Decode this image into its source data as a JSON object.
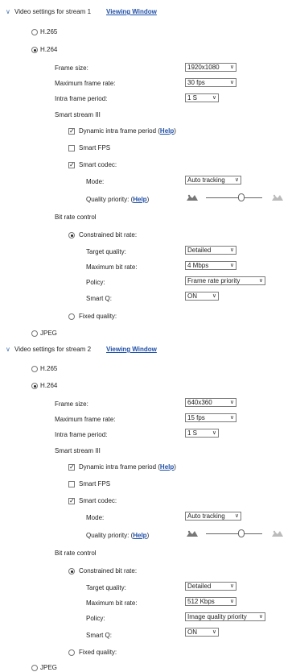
{
  "stream1": {
    "header": "Video settings for stream 1",
    "viewing_window": "Viewing Window",
    "h265": "H.265",
    "h264": "H.264",
    "frame_size_label": "Frame size:",
    "frame_size_value": "1920x1080",
    "max_frame_rate_label": "Maximum frame rate:",
    "max_frame_rate_value": "30 fps",
    "intra_period_label": "Intra frame period:",
    "intra_period_value": "1 S",
    "smart_stream": "Smart stream III",
    "dynamic_intra": "Dynamic intra frame period (",
    "help": "Help",
    "close_paren": ")",
    "smart_fps": "Smart FPS",
    "smart_codec": "Smart codec:",
    "mode_label": "Mode:",
    "mode_value": "Auto tracking",
    "quality_priority": "Quality priority: (",
    "bitrate_control": "Bit rate control",
    "constrained": "Constrained bit rate:",
    "target_quality_label": "Target quality:",
    "target_quality_value": "Detailed",
    "max_bitrate_label": "Maximum bit rate:",
    "max_bitrate_value": "4 Mbps",
    "policy_label": "Policy:",
    "policy_value": "Frame rate priority",
    "smartq_label": "Smart Q:",
    "smartq_value": "ON",
    "fixed_quality": "Fixed quality:",
    "jpeg": "JPEG",
    "quality_level": 0.35
  },
  "stream2": {
    "header": "Video settings for stream 2",
    "viewing_window": "Viewing Window",
    "h265": "H.265",
    "h264": "H.264",
    "frame_size_label": "Frame size:",
    "frame_size_value": "640x360",
    "max_frame_rate_label": "Maximum frame rate:",
    "max_frame_rate_value": "15 fps",
    "intra_period_label": "Intra frame period:",
    "intra_period_value": "1 S",
    "smart_stream": "Smart stream III",
    "dynamic_intra": "Dynamic intra frame period (",
    "help": "Help",
    "close_paren": ")",
    "smart_fps": "Smart FPS",
    "smart_codec": "Smart codec:",
    "mode_label": "Mode:",
    "mode_value": "Auto tracking",
    "quality_priority": "Quality priority: (",
    "bitrate_control": "Bit rate control",
    "constrained": "Constrained bit rate:",
    "target_quality_label": "Target quality:",
    "target_quality_value": "Detailed",
    "max_bitrate_label": "Maximum bit rate:",
    "max_bitrate_value": "512 Kbps",
    "policy_label": "Policy:",
    "policy_value": "Image quality priority",
    "smartq_label": "Smart Q:",
    "smartq_value": "ON",
    "fixed_quality": "Fixed quality:",
    "jpeg": "JPEG",
    "quality_level": 0.35
  }
}
